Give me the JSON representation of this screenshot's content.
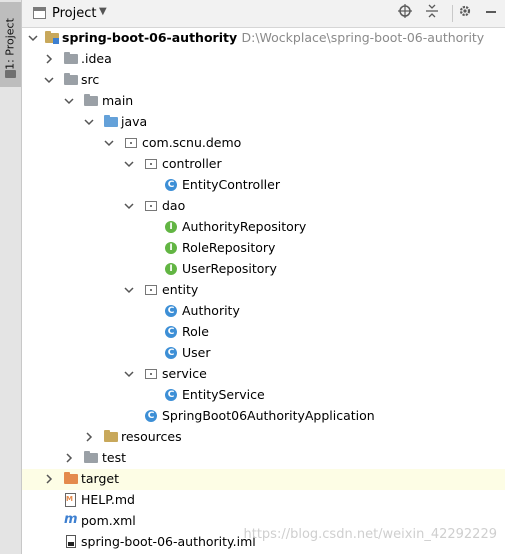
{
  "side_tab": {
    "label": "1: Project"
  },
  "toolbar": {
    "title": "Project",
    "caret": "▼"
  },
  "tree": {
    "root": {
      "name": "spring-boot-06-authority",
      "path": "D:\\Wockplace\\spring-boot-06-authority"
    },
    "idea": ".idea",
    "src": "src",
    "main": "main",
    "java": "java",
    "package": "com.scnu.demo",
    "controller": "controller",
    "entity_controller": "EntityController",
    "dao": "dao",
    "authority_repository": "AuthorityRepository",
    "role_repository": "RoleRepository",
    "user_repository": "UserRepository",
    "entity": "entity",
    "authority": "Authority",
    "role": "Role",
    "user": "User",
    "service": "service",
    "entity_service": "EntityService",
    "application": "SpringBoot06AuthorityApplication",
    "resources": "resources",
    "test": "test",
    "target": "target",
    "help_md": "HELP.md",
    "pom_xml": "pom.xml",
    "iml": "spring-boot-06-authority.iml"
  },
  "icons": {
    "class_letter": "C",
    "interface_letter": "I"
  },
  "watermark": "https://blog.csdn.net/weixin_42292229"
}
